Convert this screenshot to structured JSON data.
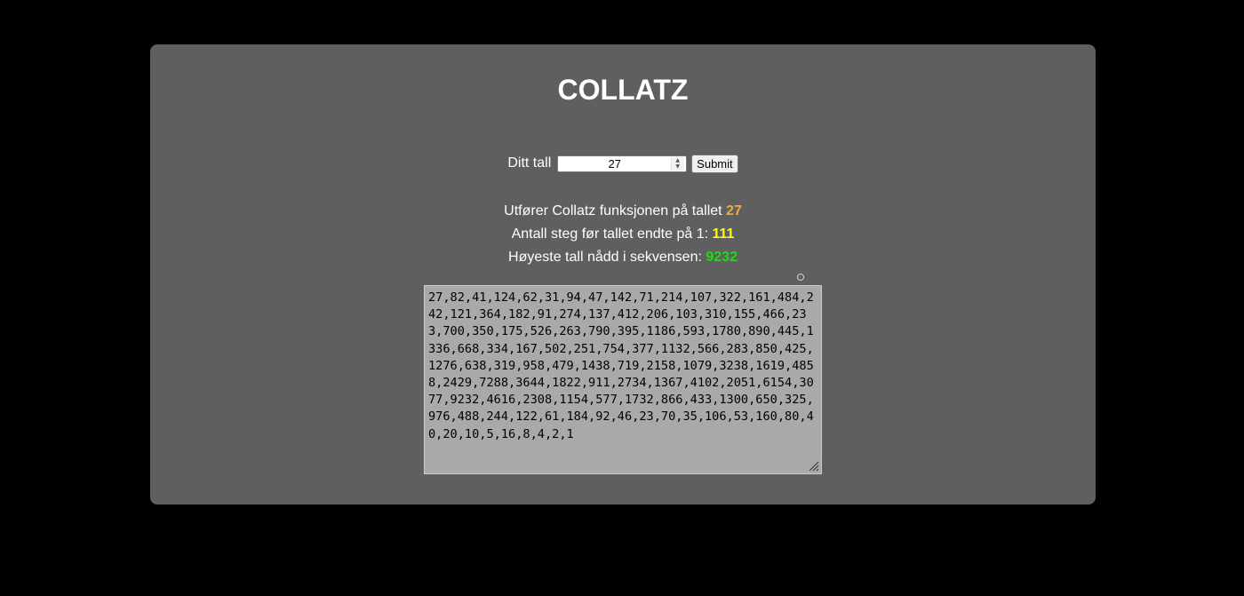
{
  "page": {
    "title": "COLLATZ"
  },
  "form": {
    "label": "Ditt tall",
    "input_value": "27",
    "submit_label": "Submit"
  },
  "results": {
    "line1_text": "Utfører Collatz funksjonen på tallet ",
    "line1_value": "27",
    "line2_text": "Antall steg før tallet endte på 1: ",
    "line2_value": "111",
    "line3_text": "Høyeste tall nådd i sekvensen: ",
    "line3_value": "9232"
  },
  "sequence": {
    "text": "27,82,41,124,62,31,94,47,142,71,214,107,322,161,484,242,121,364,182,91,274,137,412,206,103,310,155,466,233,700,350,175,526,263,790,395,1186,593,1780,890,445,1336,668,334,167,502,251,754,377,1132,566,283,850,425,1276,638,319,958,479,1438,719,2158,1079,3238,1619,4858,2429,7288,3644,1822,911,2734,1367,4102,2051,6154,3077,9232,4616,2308,1154,577,1732,866,433,1300,650,325,976,488,244,122,61,184,92,46,23,70,35,106,53,160,80,40,20,10,5,16,8,4,2,1"
  },
  "colors": {
    "page_background": "#000000",
    "card_background": "#5f5f5f",
    "starting_number": "#f2a93b",
    "steps_count": "#ffff00",
    "max_value": "#16e10e",
    "textarea_background": "#a9a9a9"
  },
  "icons": {
    "spinner": "spinner-arrows-icon",
    "resize": "resize-grip-icon"
  }
}
